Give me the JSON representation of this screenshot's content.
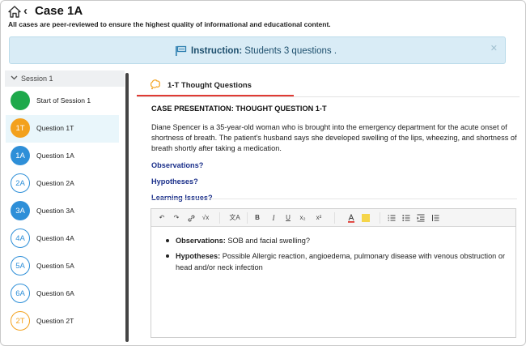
{
  "header": {
    "title": "Case 1A",
    "subtitle": "All cases are peer-reviewed to ensure the highest quality of informational and educational content."
  },
  "instruction": {
    "label": "Instruction:",
    "text": "Students 3 questions ."
  },
  "sidebar": {
    "session_label": "Session 1",
    "items": [
      {
        "badge": "",
        "label": "Start of Session 1",
        "style": "green"
      },
      {
        "badge": "1T",
        "label": "Question 1T",
        "style": "filled-orange",
        "active": true
      },
      {
        "badge": "1A",
        "label": "Question 1A",
        "style": "filled-blue"
      },
      {
        "badge": "2A",
        "label": "Question 2A",
        "style": "outline-blue"
      },
      {
        "badge": "3A",
        "label": "Question 3A",
        "style": "filled-blue"
      },
      {
        "badge": "4A",
        "label": "Question 4A",
        "style": "outline-blue"
      },
      {
        "badge": "5A",
        "label": "Question 5A",
        "style": "outline-blue"
      },
      {
        "badge": "6A",
        "label": "Question 6A",
        "style": "outline-blue"
      },
      {
        "badge": "2T",
        "label": "Question 2T",
        "style": "outline-orange"
      }
    ]
  },
  "tab": {
    "label": "1-T Thought Questions"
  },
  "content": {
    "heading": "CASE PRESENTATION: THOUGHT QUESTION 1-T",
    "body": "Diane Spencer is a 35-year-old woman who is brought into the emergency department for the acute onset of shortness of breath. The patient's husband says she developed swelling of the lips, wheezing, and shortness of breath shortly after taking a medication.",
    "links": [
      "Observations?",
      "Hypotheses?",
      "Learning Issues?"
    ]
  },
  "toolbar": {
    "undo": "↶",
    "redo": "↷",
    "link": "🔗",
    "formula": "√x",
    "translate": "文A",
    "bold": "B",
    "italic": "I",
    "underline": "U",
    "subscript": "x₂",
    "superscript": "x²",
    "text_color": "#e03a33",
    "highlight_color": "#f5d54a"
  },
  "editor": {
    "items": [
      {
        "label": "Observations:",
        "text": " SOB and facial swelling?"
      },
      {
        "label": "Hypotheses:",
        "text": " Possible Allergic reaction, angioedema, pulmonary disease with venous obstruction or head and/or neck infection"
      }
    ]
  },
  "colors": {
    "accent_red": "#e03a33",
    "instruction_bg": "#d9ecf6",
    "link_blue": "#1a2f8a"
  }
}
